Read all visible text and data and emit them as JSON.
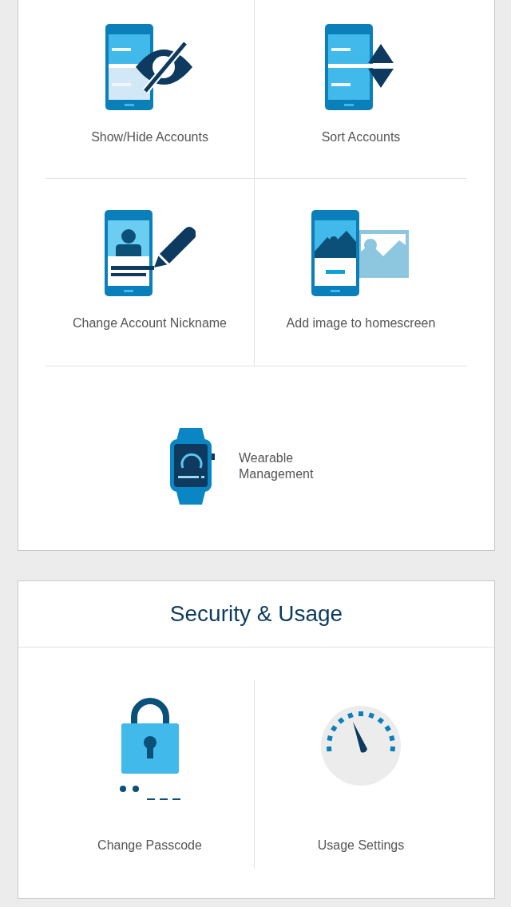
{
  "accounts_panel": {
    "items": [
      {
        "kind": "show-hide",
        "label": "Show/Hide Accounts"
      },
      {
        "kind": "sort",
        "label": "Sort Accounts"
      },
      {
        "kind": "nickname",
        "label": "Change Account Nickname"
      },
      {
        "kind": "image",
        "label": "Add image to homescreen"
      }
    ],
    "wearable": {
      "kind": "watch",
      "label": "Wearable Management"
    }
  },
  "security_panel": {
    "title": "Security & Usage",
    "items": [
      {
        "kind": "passcode",
        "label": "Change Passcode"
      },
      {
        "kind": "usage",
        "label": "Usage Settings"
      }
    ]
  }
}
